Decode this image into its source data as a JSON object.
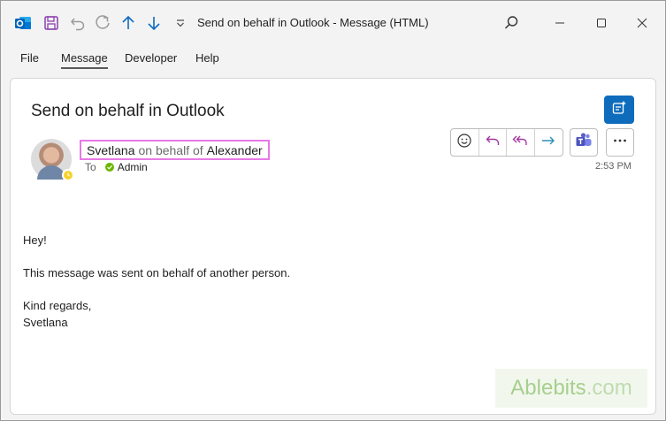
{
  "window": {
    "title": "Send on behalf in Outlook  -  Message (HTML)"
  },
  "titlebar": {
    "icons": [
      "outlook-app-icon",
      "save-icon",
      "undo-icon",
      "redo-icon",
      "previous-item-icon",
      "next-item-icon",
      "customize-toolbar-icon",
      "search-icon"
    ],
    "window_controls": [
      "minimize-icon",
      "maximize-icon",
      "close-icon"
    ]
  },
  "ribbon": {
    "tabs": [
      {
        "label": "File"
      },
      {
        "label": "Message",
        "active": true
      },
      {
        "label": "Developer"
      },
      {
        "label": "Help"
      }
    ]
  },
  "message": {
    "subject": "Send on behalf in Outlook",
    "sender": "Svetlana",
    "on_behalf_text": "on behalf of",
    "delegator": "Alexander",
    "to_label": "To",
    "recipient": "Admin",
    "time": "2:53 PM",
    "presence_status": "away",
    "body": {
      "greeting": "Hey!",
      "line1": "This message was sent on behalf of another person.",
      "closing": "Kind regards,",
      "signature": "Svetlana"
    }
  },
  "actions": [
    "emoji-react-icon",
    "reply-icon",
    "reply-all-icon",
    "forward-icon",
    "teams-icon",
    "more-actions-icon",
    "new-message-icon"
  ],
  "watermark": {
    "brand": "Ablebits",
    "suffix": ".com"
  },
  "colors": {
    "accent_blue": "#0f6cbd",
    "highlight_border": "#e879e8",
    "presence_away": "#f8d22a",
    "recipient_ok": "#6bb700",
    "reply_purple": "#a4379f",
    "forward_teal": "#2e8fb8",
    "teams_purple": "#5b5fc7"
  }
}
